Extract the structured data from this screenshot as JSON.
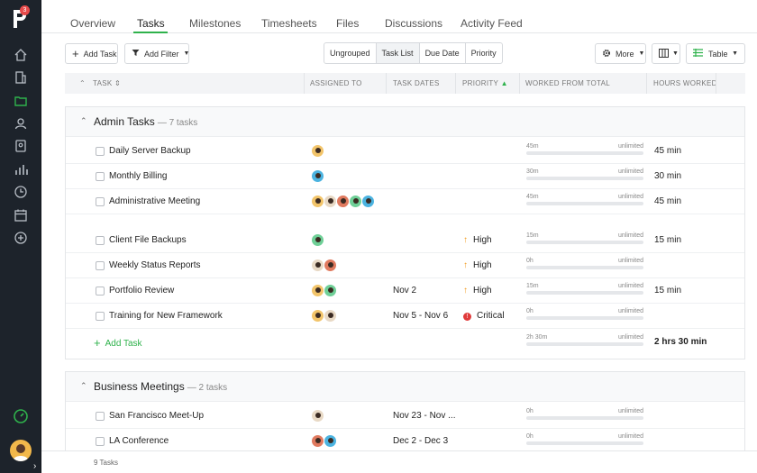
{
  "sidebar": {
    "logo_badge": "3",
    "icons": [
      "home-icon",
      "building-icon",
      "folder-icon",
      "user-icon",
      "contacts-icon",
      "reports-icon",
      "clock-icon",
      "calendar-icon",
      "add-circle-icon"
    ],
    "timer_icon": "timer-icon",
    "expand_label": "›"
  },
  "tabs": [
    {
      "label": "Overview",
      "active": false
    },
    {
      "label": "Tasks",
      "active": true
    },
    {
      "label": "Milestones",
      "active": false
    },
    {
      "label": "Timesheets",
      "active": false
    },
    {
      "label": "Files",
      "active": false
    },
    {
      "label": "Discussions",
      "active": false
    },
    {
      "label": "Activity Feed",
      "active": false
    }
  ],
  "toolbar": {
    "add_task": "Add Task",
    "add_filter": "Add Filter",
    "groupings": [
      {
        "label": "Ungrouped",
        "selected": false
      },
      {
        "label": "Task List",
        "selected": true
      },
      {
        "label": "Due Date",
        "selected": false
      },
      {
        "label": "Priority",
        "selected": false
      }
    ],
    "more": "More",
    "view": "Table"
  },
  "columns": {
    "task": "Task",
    "assigned_to": "Assigned To",
    "task_dates": "Task Dates",
    "priority": "Priority",
    "worked_from_total": "Worked From Total",
    "hours_worked": "Hours Worked"
  },
  "groups": [
    {
      "title": "Admin Tasks",
      "count": "— 7 tasks",
      "tasks": [
        {
          "name": "Daily Server Backup",
          "avatars": [
            "#f2c46a"
          ],
          "dates": "",
          "priority": "",
          "worked": "45m",
          "total": "unlimited",
          "hours": "45 min"
        },
        {
          "name": "Monthly Billing",
          "avatars": [
            "#4bb3e0"
          ],
          "dates": "",
          "priority": "",
          "worked": "30m",
          "total": "unlimited",
          "hours": "30 min"
        },
        {
          "name": "Administrative Meeting",
          "avatars": [
            "#f2c46a",
            "#e8d9c5",
            "#e07a5f",
            "#6fcf97",
            "#4bb3e0"
          ],
          "dates": "",
          "priority": "",
          "worked": "45m",
          "total": "unlimited",
          "hours": "45 min"
        },
        {
          "name": "Client File Backups",
          "avatars": [
            "#6fcf97"
          ],
          "dates": "",
          "priority": "High",
          "worked": "15m",
          "total": "unlimited",
          "hours": "15 min"
        },
        {
          "name": "Weekly Status Reports",
          "avatars": [
            "#e8d9c5",
            "#e07a5f"
          ],
          "dates": "",
          "priority": "High",
          "worked": "0h",
          "total": "unlimited",
          "hours": ""
        },
        {
          "name": "Portfolio Review",
          "avatars": [
            "#f2c46a",
            "#6fcf97"
          ],
          "dates": "Nov 2",
          "priority": "High",
          "worked": "15m",
          "total": "unlimited",
          "hours": "15 min"
        },
        {
          "name": "Training for New Framework",
          "avatars": [
            "#f2c46a",
            "#e8d9c5"
          ],
          "dates": "Nov 5 - Nov 6",
          "priority": "Critical",
          "worked": "0h",
          "total": "unlimited",
          "hours": ""
        }
      ],
      "add_task": "Add Task",
      "total_worked": "2h 30m",
      "total_total": "unlimited",
      "total_hours": "2 hrs 30 min"
    },
    {
      "title": "Business Meetings",
      "count": "— 2 tasks",
      "tasks": [
        {
          "name": "San Francisco Meet-Up",
          "avatars": [
            "#e8d9c5"
          ],
          "dates": "Nov 23 - Nov ...",
          "priority": "",
          "worked": "0h",
          "total": "unlimited",
          "hours": ""
        },
        {
          "name": "LA Conference",
          "avatars": [
            "#e07a5f",
            "#4bb3e0"
          ],
          "dates": "Dec 2 - Dec 3",
          "priority": "",
          "worked": "0h",
          "total": "unlimited",
          "hours": ""
        }
      ]
    }
  ],
  "footer": {
    "count": "9 Tasks"
  },
  "colors": {
    "accent": "#2fb24c",
    "sidebar": "#1d232b",
    "high": "#f29a1d",
    "critical": "#e03b3b"
  }
}
